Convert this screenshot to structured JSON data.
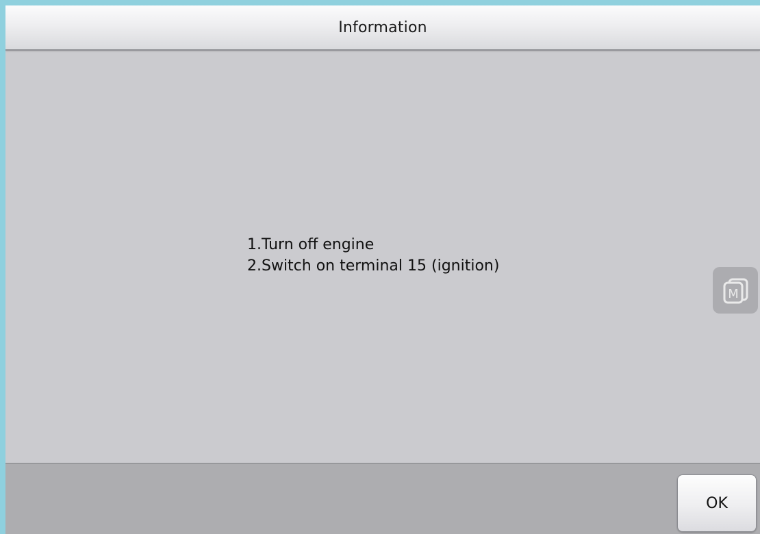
{
  "dialog": {
    "title": "Information",
    "message_lines": [
      "1.Turn off engine",
      "2.Switch on terminal 15 (ignition)"
    ],
    "ok_label": "OK"
  },
  "side_widget": {
    "icon": "m-icon",
    "letter": "M"
  },
  "colors": {
    "background_accent": "#8fd0de",
    "dialog_body": "#cbcbcf",
    "footer": "#adadb0"
  }
}
